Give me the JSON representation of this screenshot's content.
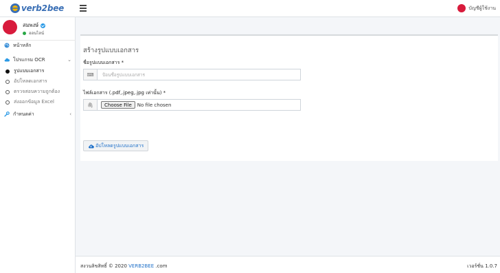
{
  "header": {
    "logo_text": "verb2bee",
    "account_label": "บัญชีผู้ใช้งาน"
  },
  "sidebar": {
    "user": {
      "name": "สมพงษ์",
      "status": "ออนไลน์"
    },
    "items": [
      {
        "label": "หน้าหลัก",
        "icon": "palette-icon"
      },
      {
        "label": "โปรแกรม OCR",
        "icon": "cloud-icon",
        "expanded": true,
        "children": [
          {
            "label": "รูปแบบเอกสาร",
            "active": true
          },
          {
            "label": "อัปโหลดเอกสาร",
            "active": false
          },
          {
            "label": "ตรวจสอบความถูกต้อง",
            "active": false
          },
          {
            "label": "ส่งออกข้อมูล Excel",
            "active": false
          }
        ]
      },
      {
        "label": "กำหนดค่า",
        "icon": "wrench-icon"
      }
    ]
  },
  "form": {
    "title": "สร้างรูปแบบเอกสาร",
    "name_label": "ชื่อรูปแบบเอกสาร *",
    "name_placeholder": "ป้อนชื่อรูปแบบเอกสาร",
    "file_label": "ไฟล์เอกสาร (.pdf,.jpeg,.jpg เท่านั้น) *",
    "file_button": "Choose File",
    "file_status": "No file chosen",
    "upload_button": "อัปโหลดรูปแบบเอกสาร"
  },
  "footer": {
    "copyright": "สงวนลิขสิทธิ์ © 2020 ",
    "brand": "VERB2BEE",
    "suffix": " .com",
    "version": "เวอร์ชั่น 1.0.7"
  },
  "colors": {
    "accent": "#1e6fc8",
    "brand_red": "#d81b3c",
    "online": "#28a745"
  }
}
